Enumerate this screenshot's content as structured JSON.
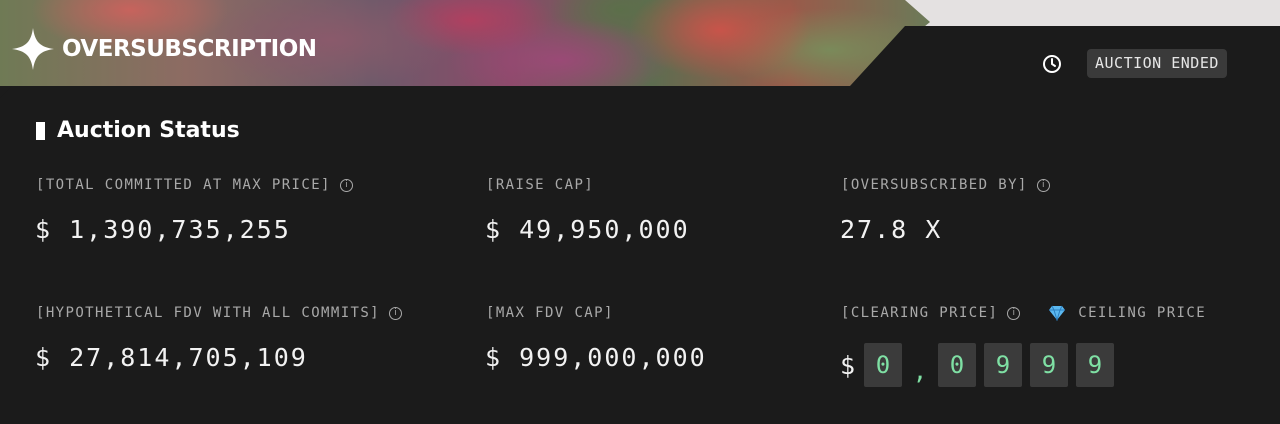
{
  "header": {
    "brand": "OVERSUBSCRIPTION",
    "status_badge": "AUCTION ENDED"
  },
  "section": {
    "title": "Auction Status"
  },
  "stats": {
    "total_committed_label": "[TOTAL COMMITTED AT MAX PRICE]",
    "total_committed_value": "$ 1,390,735,255",
    "raise_cap_label": "[RAISE CAP]",
    "raise_cap_value": "$ 49,950,000",
    "oversubscribed_label": "[OVERSUBSCRIBED BY]",
    "oversubscribed_value": "27.8 X",
    "fdv_label": "[HYPOTHETICAL FDV WITH ALL COMMITS]",
    "fdv_value": "$ 27,814,705,109",
    "max_fdv_label": "[MAX FDV CAP]",
    "max_fdv_value": "$ 999,000,000",
    "clearing_label": "[CLEARING PRICE]",
    "ceiling_label": "CEILING PRICE",
    "clearing_currency": "$",
    "clearing_digits": [
      "0",
      ",",
      "0",
      "9",
      "9",
      "9"
    ]
  },
  "icons": {
    "brand": "sparkle-icon",
    "clock": "clock-icon",
    "info": "info-icon",
    "gem": "gem-icon"
  },
  "colors": {
    "panel": "#1b1b1b",
    "digit_highlight": "#7fe0a4",
    "badge_bg": "#3a3a3a"
  }
}
